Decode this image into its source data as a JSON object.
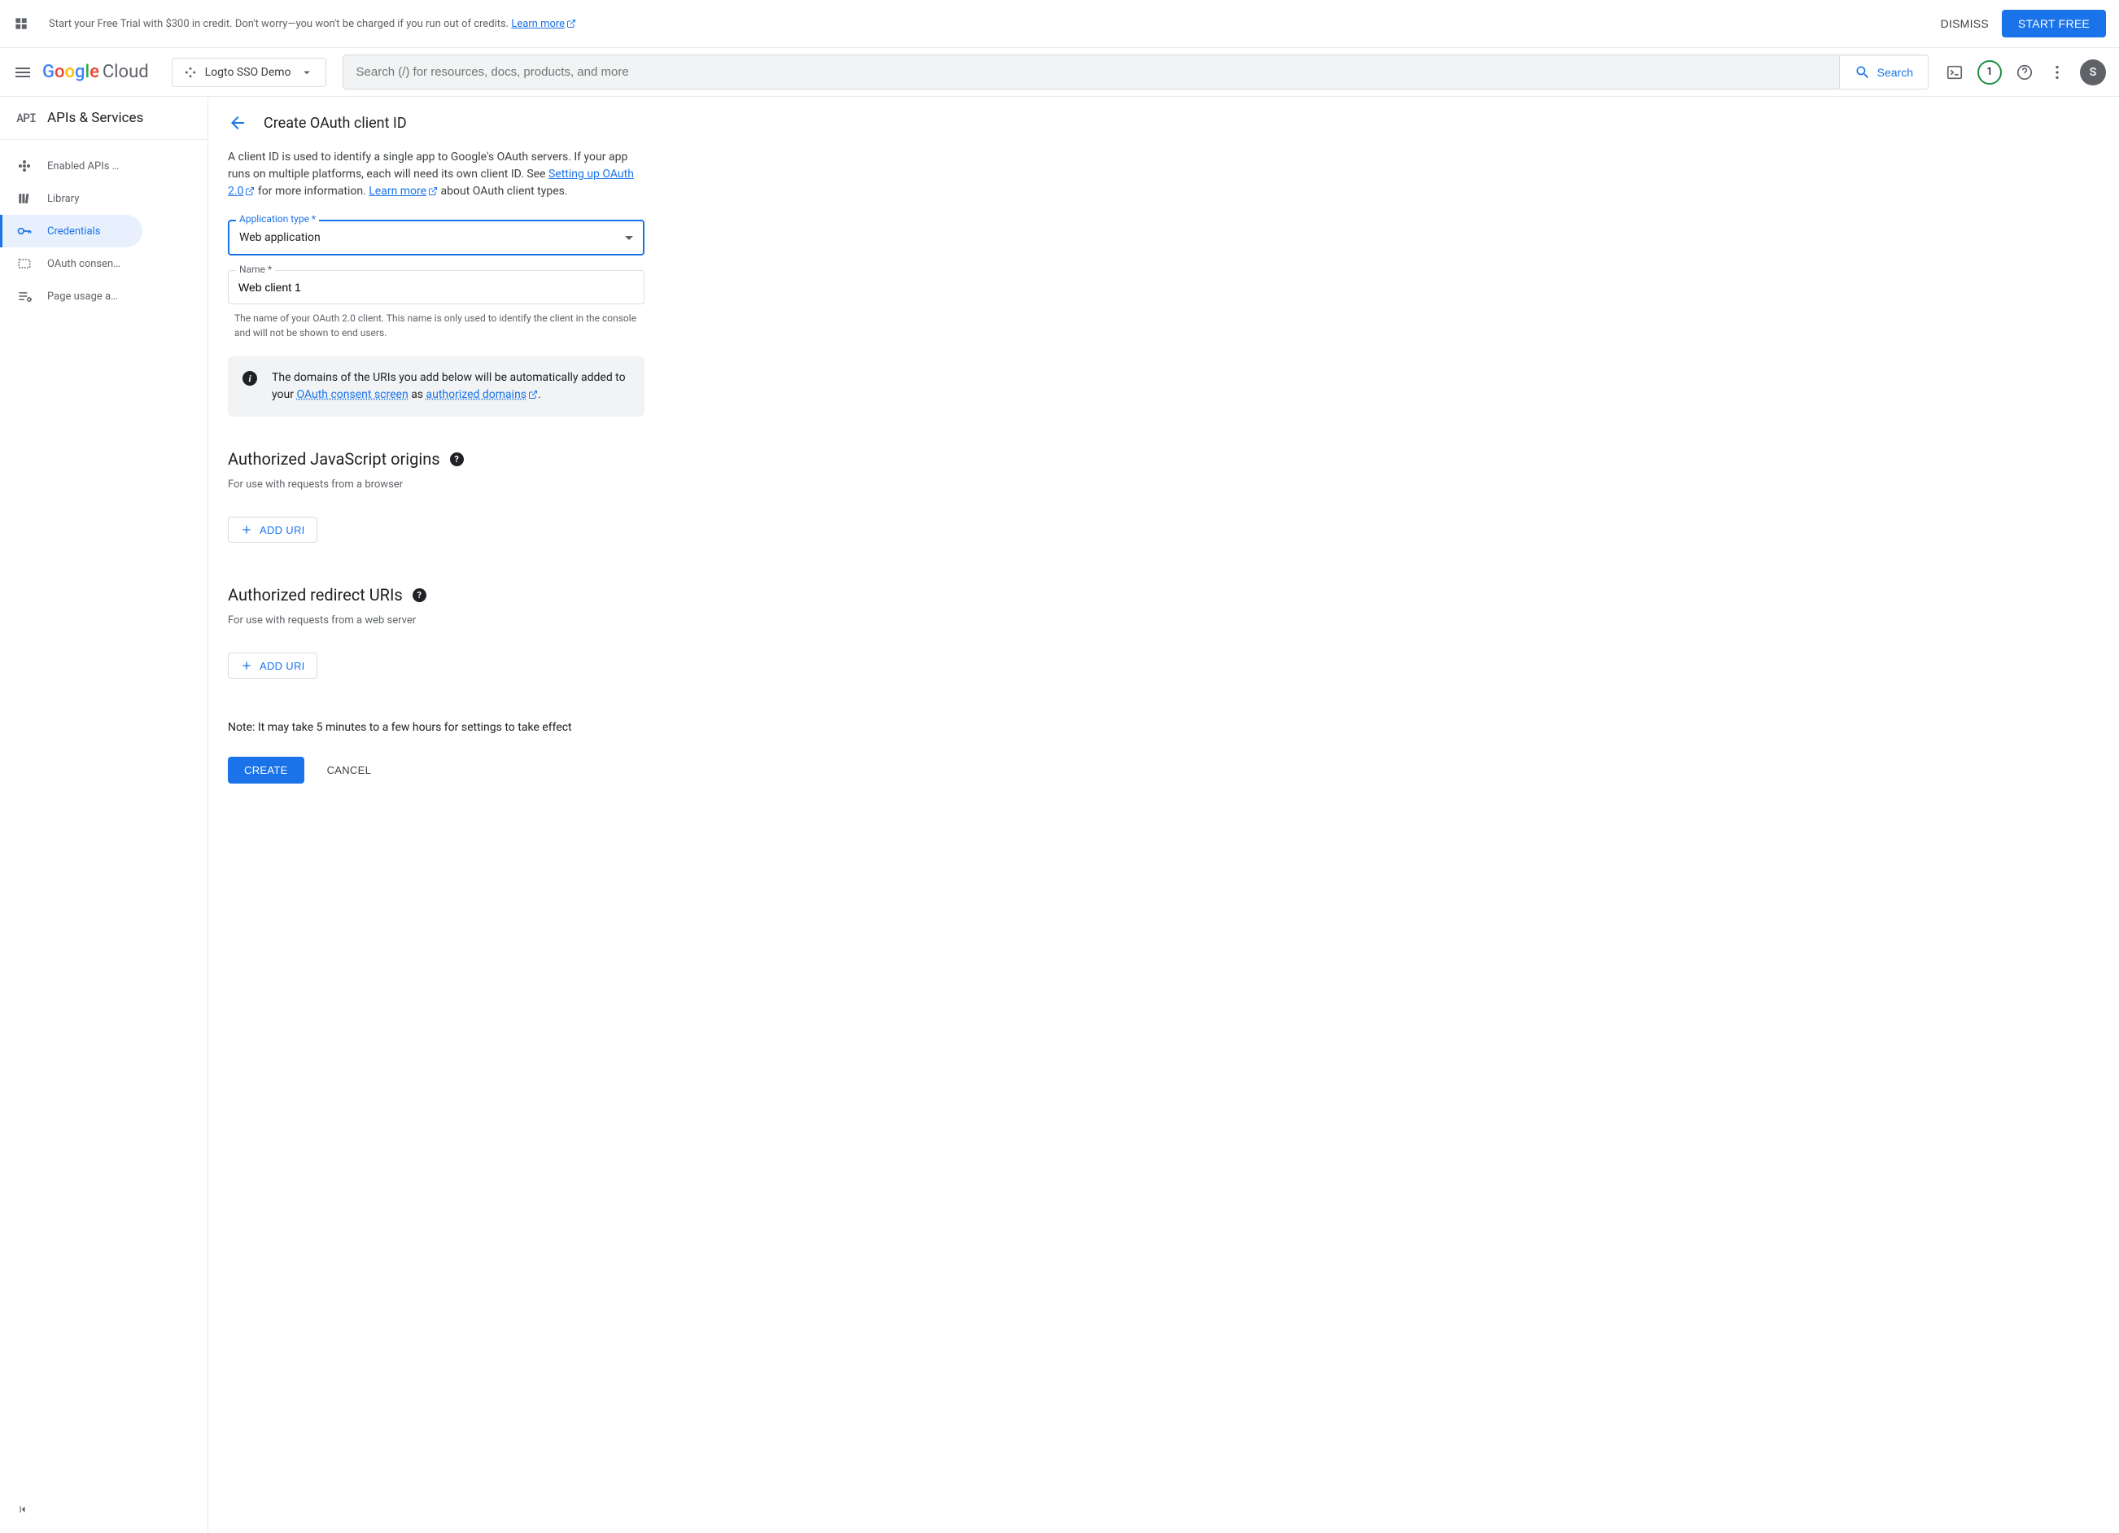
{
  "banner": {
    "text_1": "Start your Free Trial with $300 in credit. Don't worry—you won't be charged if you run out of credits. ",
    "learn_more": "Learn more",
    "dismiss": "DISMISS",
    "start_free": "START FREE"
  },
  "header": {
    "logo_cloud": "Cloud",
    "project_name": "Logto SSO Demo",
    "search_placeholder": "Search (/) for resources, docs, products, and more",
    "search_btn": "Search",
    "trial_count": "1",
    "avatar_initial": "S"
  },
  "sidebar": {
    "title": "APIs & Services",
    "api_label": "API",
    "items": [
      {
        "label": "Enabled APIs …"
      },
      {
        "label": "Library"
      },
      {
        "label": "Credentials"
      },
      {
        "label": "OAuth consen…"
      },
      {
        "label": "Page usage a…"
      }
    ]
  },
  "content": {
    "title": "Create OAuth client ID",
    "intro_1": "A client ID is used to identify a single app to Google's OAuth servers. If your app runs on multiple platforms, each will need its own client ID. See ",
    "intro_link_1": "Setting up OAuth 2.0",
    "intro_2": " for more information. ",
    "intro_link_2": "Learn more",
    "intro_3": " about OAuth client types.",
    "app_type_label": "Application type *",
    "app_type_value": "Web application",
    "name_label": "Name *",
    "name_value": "Web client 1",
    "name_help": "The name of your OAuth 2.0 client. This name is only used to identify the client in the console and will not be shown to end users.",
    "info_text_1": "The domains of the URIs you add below will be automatically added to your ",
    "info_link_1": "OAuth consent screen",
    "info_text_2": " as ",
    "info_link_2": "authorized domains",
    "info_text_3": ".",
    "js_origins_title": "Authorized JavaScript origins",
    "js_origins_desc": "For use with requests from a browser",
    "redirect_uris_title": "Authorized redirect URIs",
    "redirect_uris_desc": "For use with requests from a web server",
    "add_uri": "ADD URI",
    "note": "Note: It may take 5 minutes to a few hours for settings to take effect",
    "create": "CREATE",
    "cancel": "CANCEL"
  }
}
